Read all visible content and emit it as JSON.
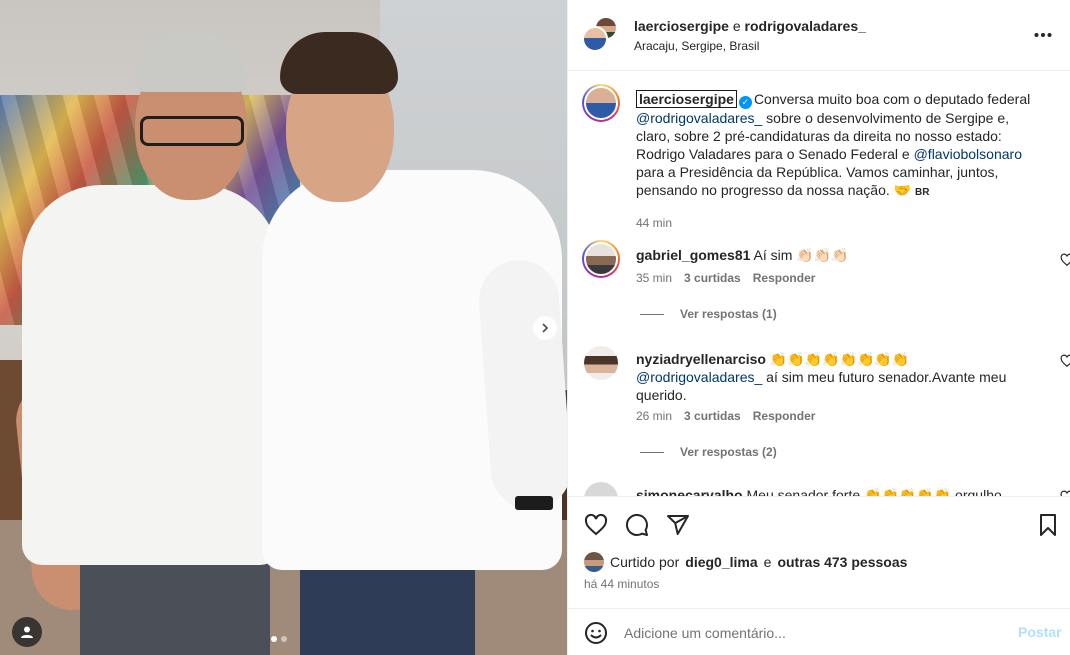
{
  "header": {
    "user1": "laerciosergipe",
    "conjunction": "e",
    "user2": "rodrigovaladares_",
    "location": "Aracaju, Sergipe, Brasil"
  },
  "caption": {
    "username": "laerciosergipe",
    "verified": true,
    "text_1": "Conversa muito boa com o deputado federal",
    "mention_1": "@rodrigovaladares_",
    "text_2": "sobre o desenvolvimento de Sergipe e, claro, sobre 2 pré-candidaturas da direita no nosso estado: Rodrigo Valadares para o Senado Federal e",
    "mention_2": "@flaviobolsonaro",
    "text_3": "para a Presidência da República. Vamos caminhar, juntos, pensando no progresso da nossa nação. 🤝",
    "flag": "BR",
    "time": "44 min"
  },
  "comments": [
    {
      "username": "gabriel_gomes81",
      "text": "Aí sim 👏🏻👏🏻👏🏻",
      "time": "35 min",
      "likes": "3 curtidas",
      "reply": "Responder",
      "view_replies": "Ver respostas (1)"
    },
    {
      "username": "nyziadryellenarciso",
      "emojis": "👏👏👏👏👏👏👏👏",
      "mention": "@rodrigovaladares_",
      "text": "aí sim meu futuro senador.Avante meu querido.",
      "time": "26 min",
      "likes": "3 curtidas",
      "reply": "Responder",
      "view_replies": "Ver respostas (2)"
    },
    {
      "username": "simonecarvalho",
      "text": "Meu senador forte 👏👏👏👏👏 orgulho"
    }
  ],
  "likes": {
    "prefix": "Curtido por",
    "user": "dieg0_lima",
    "conj": "e",
    "others": "outras 473 pessoas"
  },
  "posted": "há 44 minutos",
  "add_comment": {
    "placeholder": "Adicione um comentário...",
    "post_label": "Postar"
  },
  "icons": {
    "like": "heart-icon",
    "comment": "comment-icon",
    "share": "share-icon",
    "save": "bookmark-icon",
    "more": "more-icon",
    "emoji": "emoji-icon",
    "next": "chevron-right-icon",
    "tag": "user-tag-icon"
  },
  "colors": {
    "mention": "#00376b",
    "verified": "#0095f6",
    "post_disabled": "#b2dffc",
    "muted": "#737373"
  }
}
